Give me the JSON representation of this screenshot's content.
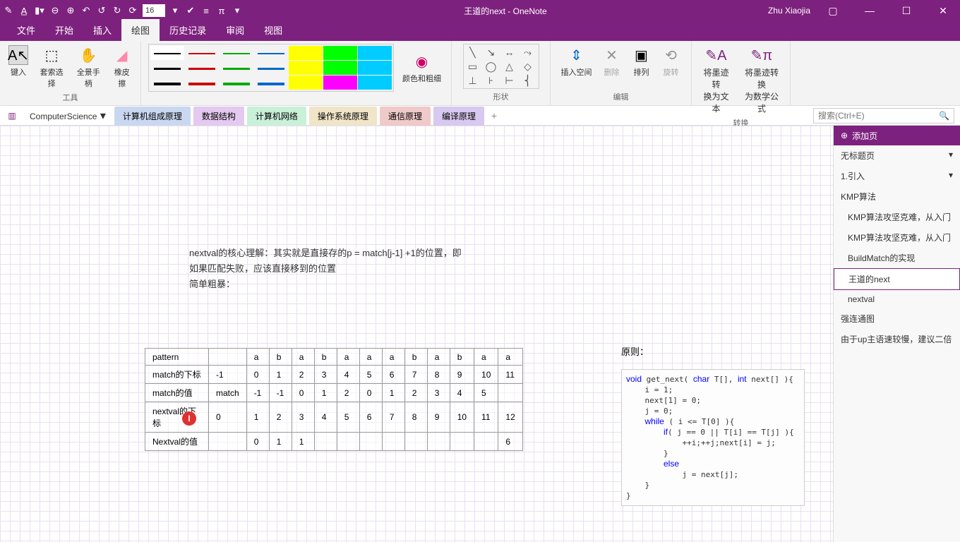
{
  "title": {
    "doc": "王道的next",
    "app": "OneNote",
    "user": "Zhu Xiaojia"
  },
  "qat": {
    "fontSize": "16"
  },
  "menus": [
    "文件",
    "开始",
    "插入",
    "绘图",
    "历史记录",
    "审阅",
    "视图"
  ],
  "activeMenu": 3,
  "ribbon": {
    "tools": {
      "keyin": "键入",
      "lasso": "套索选择",
      "pan": "全景手柄",
      "eraser": "橡皮擦",
      "label": "工具"
    },
    "pens": {
      "label": "",
      "colorThick": "颜色和粗细"
    },
    "shapes": {
      "label": "形状"
    },
    "edit": {
      "insertSpace": "插入空间",
      "delete": "删除",
      "arrange": "排列",
      "rotate": "旋转",
      "label": "编辑"
    },
    "convert": {
      "ink2text1": "将墨迹转",
      "ink2text2": "换为文本",
      "ink2math1": "将墨迹转换",
      "ink2math2": "为数学公式",
      "label": "转换"
    }
  },
  "notebook": "ComputerScience",
  "sections": [
    "计算机组成原理",
    "数据结构",
    "计算机网络",
    "操作系统原理",
    "通信原理",
    "编译原理"
  ],
  "activeSection": 1,
  "search": {
    "placeholder": "搜索(Ctrl+E)"
  },
  "notes": {
    "p1": "nextval的核心理解：其实就是直接存的p = match[j-1] +1的位置，即",
    "p2": "如果匹配失败，应该直接移到的位置",
    "p3": "简单粗暴："
  },
  "table": {
    "r1": [
      "pattern",
      "",
      "a",
      "b",
      "a",
      "b",
      "a",
      "a",
      "a",
      "b",
      "a",
      "b",
      "a",
      "a"
    ],
    "r2": [
      "match的下标",
      "-1",
      "0",
      "1",
      "2",
      "3",
      "4",
      "5",
      "6",
      "7",
      "8",
      "9",
      "10",
      "11"
    ],
    "r3": [
      "match的值",
      "match",
      "-1",
      "-1",
      "0",
      "1",
      "2",
      "0",
      "1",
      "2",
      "3",
      "4",
      "5",
      ""
    ],
    "r4": [
      "nextval的下标",
      "0",
      "1",
      "2",
      "3",
      "4",
      "5",
      "6",
      "7",
      "8",
      "9",
      "10",
      "11",
      "12"
    ],
    "r5": [
      "Nextval的值",
      "",
      "0",
      "1",
      "1",
      "",
      "",
      "",
      "",
      "",
      "",
      "",
      "",
      "6"
    ]
  },
  "code": {
    "title": "原则：",
    "text": "void get_next( char T[], int next[] ){\n    i = 1;\n    next[1] = 0;\n    j = 0;\n    while ( i <= T[0] ){\n        if( j == 0 || T[i] == T[j] ){\n            ++i;++j;next[i] = j;\n        }\n        else\n            j = next[j];\n    }\n}"
  },
  "sidebar": {
    "addPage": "添加页",
    "pages": [
      {
        "label": "无标题页",
        "type": "top",
        "expand": true
      },
      {
        "label": "1.引入",
        "type": "top",
        "expand": true
      },
      {
        "label": "KMP算法",
        "type": "top"
      },
      {
        "label": "KMP算法攻坚克难，从入门",
        "type": "sub"
      },
      {
        "label": "KMP算法攻坚克难，从入门",
        "type": "sub"
      },
      {
        "label": "BuildMatch的实现",
        "type": "sub"
      },
      {
        "label": "王道的next",
        "type": "sub",
        "active": true
      },
      {
        "label": "nextval",
        "type": "sub"
      },
      {
        "label": "强连通图",
        "type": "top"
      },
      {
        "label": "由于up主语速较慢，建议二倍",
        "type": "top"
      }
    ]
  }
}
